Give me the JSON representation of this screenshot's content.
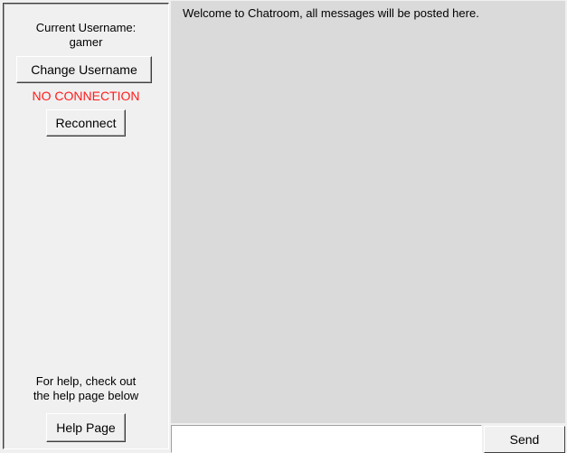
{
  "sidebar": {
    "username_label": "Current Username:",
    "username_value": "gamer",
    "change_username_button": "Change Username",
    "connection_status": "NO CONNECTION",
    "reconnect_button": "Reconnect",
    "help_text_line1": "For help, check out",
    "help_text_line2": "the help page below",
    "help_button": "Help Page"
  },
  "chat": {
    "messages": [
      "Welcome to Chatroom, all messages will be posted here."
    ]
  },
  "composer": {
    "input_value": "",
    "send_label": "Send"
  },
  "colors": {
    "status_error": "#ff1a1a",
    "chat_background": "#dadada",
    "window_background": "#f0f0f0"
  }
}
